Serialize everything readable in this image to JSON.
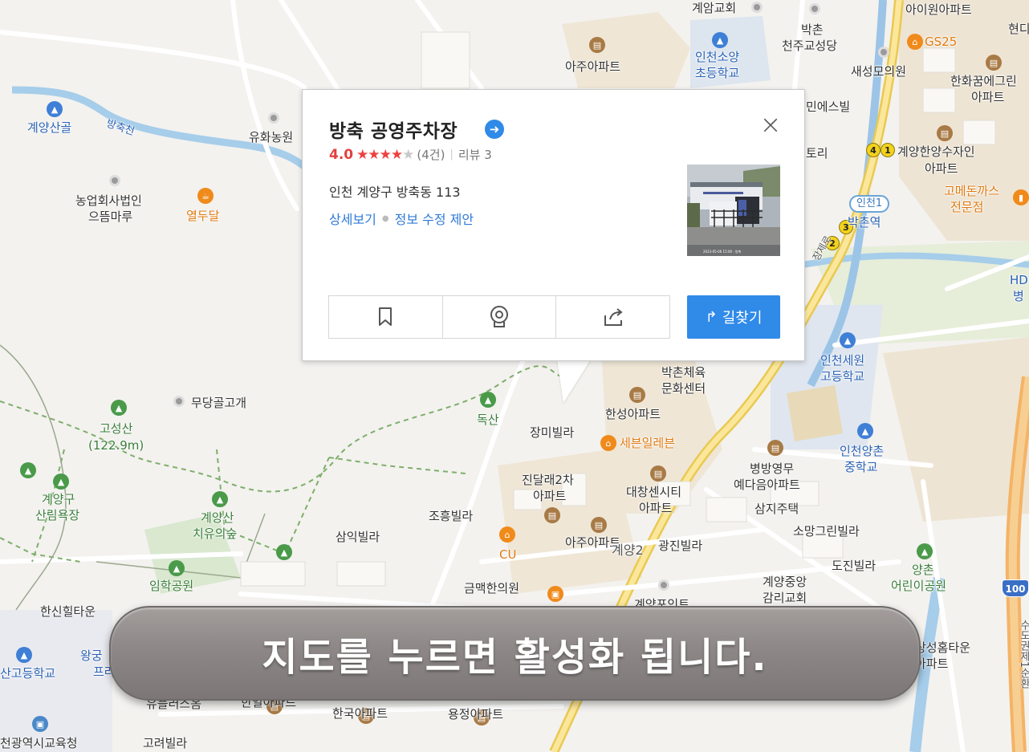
{
  "popup": {
    "title": "방축 공영주차장",
    "rating": "4.0",
    "stars_filled": 4,
    "stars_total": 5,
    "rating_count": "(4건)",
    "separator": "|",
    "review": "리뷰 3",
    "address": "인천 계양구 방축동 113",
    "link_details": "상세보기",
    "link_edit": "정보 수정 제안",
    "close_symbol": "×",
    "directions_label": "길찾기",
    "action_icons": [
      "bookmark-icon",
      "roadview-icon",
      "share-icon"
    ],
    "photo_caption": "2023-05-06 15:00 · 방축"
  },
  "banner": {
    "text": "지도를 누르면 활성화 됩니다."
  },
  "map": {
    "labels": {
      "gyeyang_church": "계암교회",
      "bakchon_catholic_1": "박촌",
      "bakchon_catholic_2": "천주교성당",
      "aiwon_apt": "아이원아파트",
      "hyeon": "현디",
      "gs25": "GS25",
      "saeseongmo": "새성모의원",
      "hanwha_1": "한화꿈에그린",
      "hanwha_2": "아파트",
      "aju_apt_top": "아주아파트",
      "incheon_soyang_1": "인천소양",
      "incheon_soyang_2": "초등학교",
      "gyeyangsangol": "계양산골",
      "bangchukcheon": "방축천",
      "yuhwa": "유화농원",
      "nonghyup_1": "농업회사법인",
      "nonghyup_2": "으뜸마루",
      "yeoldudal": "열두달",
      "min_eshibil": "민에스빌",
      "tori": "토리",
      "hanyang_1": "계양한양수자인",
      "hanyang_2": "아파트",
      "gome_1": "고메돈까스",
      "gome_2": "전문점",
      "bakchon_station": "박촌역",
      "incheon1": "인천1",
      "hd_1": "HD",
      "hd_2": "병",
      "bakchon_sports_1": "박촌체육",
      "bakchon_sports_2": "문화센터",
      "incheon_sewon_1": "인천세원",
      "incheon_sewon_2": "고등학교",
      "mudanggol": "무당골고개",
      "goseongsan_1": "고성산",
      "goseongsan_2": "(122.9m)",
      "doksan": "독산",
      "hanseong_apt": "한성아파트",
      "jangmi": "장미빌라",
      "seven_eleven": "세븐일레븐",
      "incheon_yangchon_1": "인천양촌",
      "incheon_yangchon_2": "중학교",
      "jindallae_1": "진달래2차",
      "jindallae_2": "아파트",
      "daechang_1": "대창센시티",
      "daechang_2": "아파트",
      "byeongbang_1": "병방영무",
      "byeongbang_2": "예다음아파트",
      "gyeyanggu_forest_1": "계양구",
      "gyeyanggu_forest_2": "산림욕장",
      "gyeyangsan_healing_1": "계양산",
      "gyeyangsan_healing_2": "치유의숲",
      "josheung": "조흥빌라",
      "samji": "삼지주택",
      "samik": "삼익빌라",
      "aju_apt_mid": "아주아파트",
      "gyeyang2": "계양2",
      "gwangjin": "광진빌라",
      "somang": "소망그린빌라",
      "cu": "CU",
      "imhak_park": "임학공원",
      "geummaek": "금맥한의원",
      "dojin": "도진빌라",
      "gyeyang_jungang_1": "계양중앙",
      "gyeyang_jungang_2": "감리교회",
      "yangchon_park_1": "양촌",
      "yangchon_park_2": "어린이공원",
      "hansin_hill": "한신힐타운",
      "wanggung_1": "왕궁",
      "wanggung_2": "프라",
      "san_high": "산고등학교",
      "sangseong_1": "상성홈타운",
      "sangseong_2": "아파트",
      "sudo_expressway": "수도권제1순환",
      "road_100": "100",
      "yupeulleoseu": "유플러스옴",
      "hanil": "한일아파트",
      "hanguk": "한국아파트",
      "yongjeong": "용정아파트",
      "incheon_edu": "천광역시교육청",
      "goryeo": "고려빌라",
      "gyeyang_point": "계양포인트",
      "jangje_ro": "장제로"
    }
  }
}
